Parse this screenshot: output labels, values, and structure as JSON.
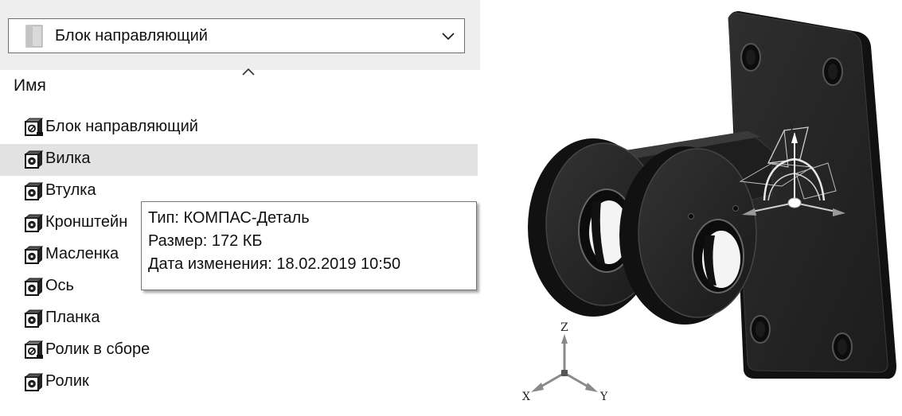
{
  "explorer": {
    "path": "Блок направляющий",
    "column_header": "Имя",
    "files": [
      {
        "name": "Блок направляющий",
        "icon": "kompas-assembly-icon",
        "selected": false
      },
      {
        "name": "Вилка",
        "icon": "kompas-part-icon",
        "selected": true
      },
      {
        "name": "Втулка",
        "icon": "kompas-part-icon",
        "selected": false
      },
      {
        "name": "Кронштейн",
        "icon": "kompas-part-icon",
        "selected": false
      },
      {
        "name": "Масленка",
        "icon": "kompas-part-icon",
        "selected": false
      },
      {
        "name": "Ось",
        "icon": "kompas-part-icon",
        "selected": false
      },
      {
        "name": "Планка",
        "icon": "kompas-part-icon",
        "selected": false
      },
      {
        "name": "Ролик в сборе",
        "icon": "kompas-assembly-icon",
        "selected": false
      },
      {
        "name": "Ролик",
        "icon": "kompas-part-icon",
        "selected": false
      }
    ],
    "tooltip": {
      "type": "Тип: КОМПАС-Деталь",
      "size": "Размер: 172 КБ",
      "modified": "Дата изменения: 18.02.2019 10:50"
    }
  },
  "viewport": {
    "triad_labels": {
      "x": "X",
      "y": "Y",
      "z": "Z"
    },
    "corner_axes": {
      "x": "X",
      "y": "Y",
      "z": "Z"
    }
  },
  "colors": {
    "selection": "#e2e2e2",
    "toolbar": "#eeeeee",
    "part_body": "#262626",
    "part_dark": "#111111"
  }
}
